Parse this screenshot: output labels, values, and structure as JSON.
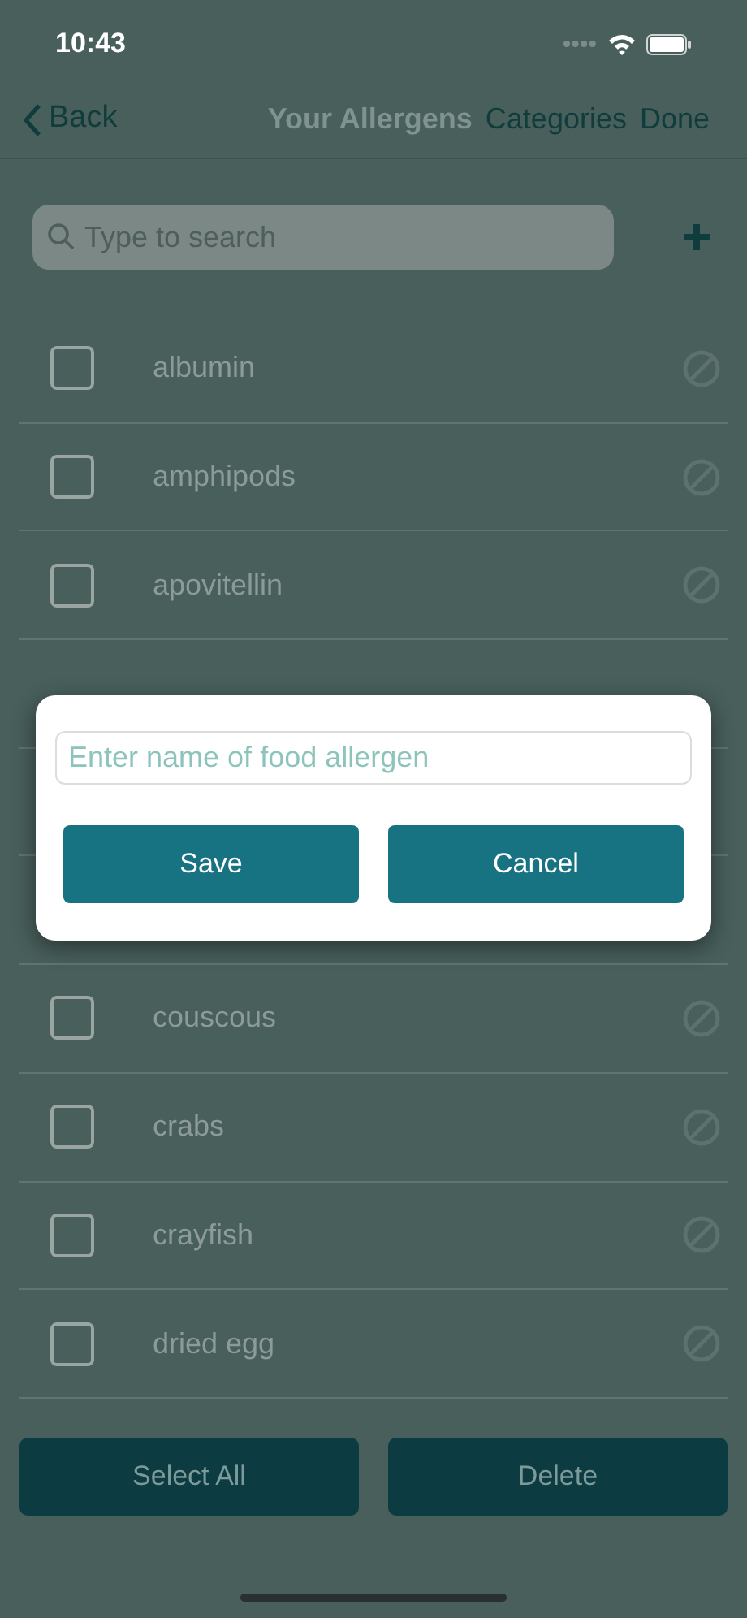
{
  "status_bar": {
    "time": "10:43"
  },
  "nav": {
    "back": "Back",
    "title": "Your Allergens",
    "actions": [
      "Categories",
      "Done"
    ]
  },
  "search": {
    "placeholder": "Type to search"
  },
  "allergens_top": [
    {
      "name": "albumin",
      "checked": false
    },
    {
      "name": "amphipods",
      "checked": false
    },
    {
      "name": "apovitellin",
      "checked": false
    }
  ],
  "allergens_bottom": [
    {
      "name": "couscous",
      "checked": false
    },
    {
      "name": "crabs",
      "checked": false
    },
    {
      "name": "crayfish",
      "checked": false
    },
    {
      "name": "dried egg",
      "checked": false
    }
  ],
  "footer_buttons": [
    "Select All",
    "Delete"
  ],
  "dialog": {
    "placeholder": "Enter name of food allergen",
    "buttons": [
      "Save",
      "Cancel"
    ]
  }
}
